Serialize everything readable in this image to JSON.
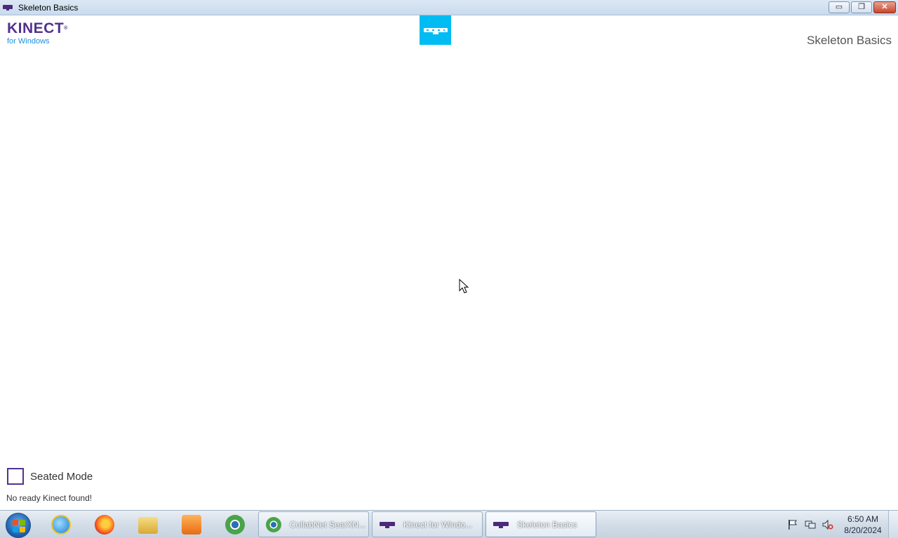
{
  "window": {
    "title": "Skeleton Basics",
    "controls": {
      "minimize": "▭",
      "maximize": "❐",
      "close": "✕"
    }
  },
  "header": {
    "logo_word": "KINECT",
    "logo_sub": "for Windows",
    "logo_tm": "®",
    "sensor_icon": "kinect-sensor-icon",
    "app_title": "Skeleton Basics"
  },
  "controls": {
    "seated_mode_label": "Seated Mode",
    "seated_mode_checked": false
  },
  "status": {
    "text": "No ready Kinect found!"
  },
  "taskbar": {
    "pinned": [
      {
        "name": "internet-explorer-icon"
      },
      {
        "name": "firefox-icon"
      },
      {
        "name": "file-explorer-icon"
      },
      {
        "name": "media-player-icon"
      },
      {
        "name": "browser-icon"
      }
    ],
    "tasks": [
      {
        "label": "CollabNet SearXN...",
        "icon": "browser-icon"
      },
      {
        "label": "Kinect for Windo...",
        "icon": "kinect-icon"
      },
      {
        "label": "Skeleton Basics",
        "icon": "kinect-icon"
      }
    ],
    "clock_time": "6:50 AM",
    "clock_date": "8/20/2024"
  },
  "colors": {
    "kinect_purple": "#52318f",
    "kinect_blue": "#00bcf2",
    "link_blue": "#1e8fd8"
  }
}
